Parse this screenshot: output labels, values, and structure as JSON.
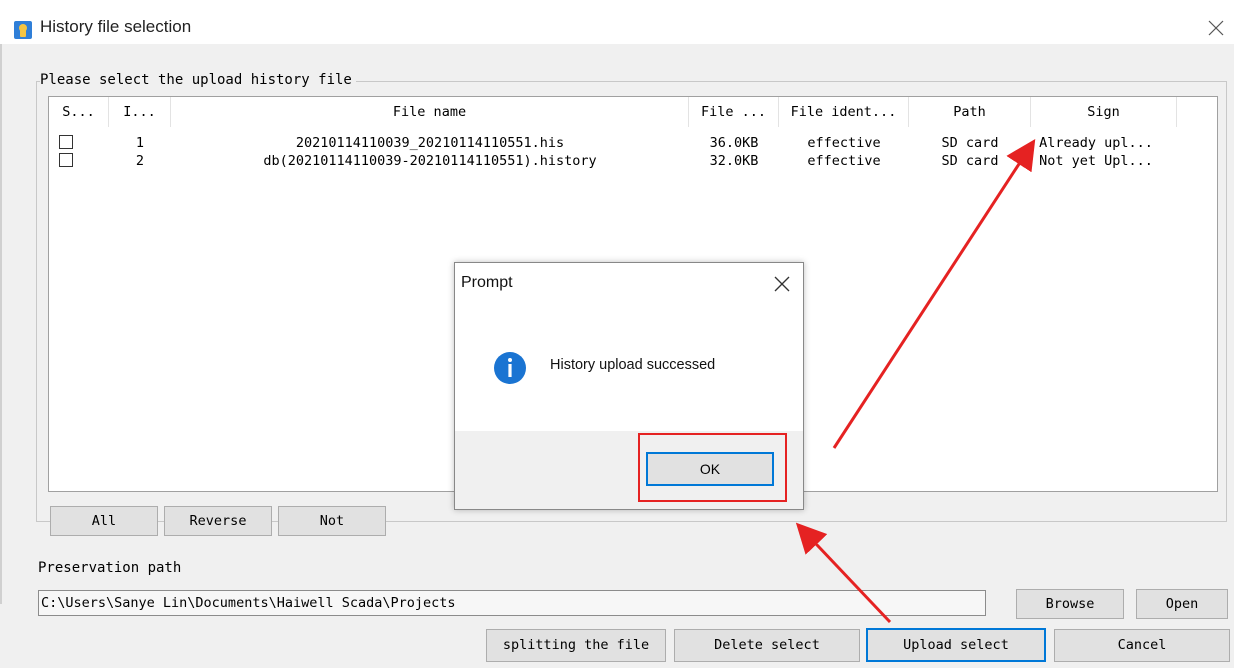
{
  "window": {
    "title": "History file selection",
    "app_icon": "app-hand-icon",
    "close_icon": "close-icon"
  },
  "group": {
    "label": "Please select the upload history file"
  },
  "table": {
    "columns": [
      "S...",
      "I...",
      "File name",
      "File ...",
      "File ident...",
      "Path",
      "Sign"
    ],
    "rows": [
      {
        "index": "1",
        "file_name": "20210114110039_20210114110551.his",
        "file_size": "36.0KB",
        "file_identity": "effective",
        "path": "SD card",
        "sign": "Already upl..."
      },
      {
        "index": "2",
        "file_name": "db(20210114110039-20210114110551).history",
        "file_size": "32.0KB",
        "file_identity": "effective",
        "path": "SD card",
        "sign": "Not yet Upl..."
      }
    ]
  },
  "selection_buttons": {
    "all": "All",
    "reverse": "Reverse",
    "not": "Not"
  },
  "preservation": {
    "label": "Preservation path",
    "path": "C:\\Users\\Sanye Lin\\Documents\\Haiwell Scada\\Projects",
    "browse": "Browse",
    "open": "Open"
  },
  "actions": {
    "split": "splitting the file",
    "delete": "Delete select",
    "upload": "Upload select",
    "cancel": "Cancel"
  },
  "prompt": {
    "title": "Prompt",
    "message": "History upload successed",
    "ok": "OK",
    "icon": "info-icon"
  },
  "colors": {
    "accent": "#0078d7",
    "annotation_red": "#e52222",
    "info_blue": "#1a74d2"
  }
}
